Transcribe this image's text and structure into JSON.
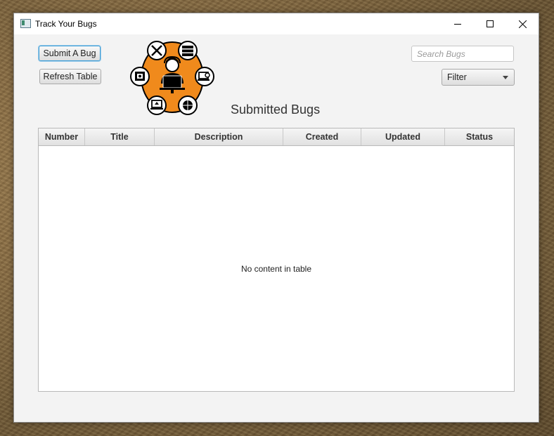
{
  "window": {
    "title": "Track Your Bugs",
    "controls": [
      "minimize-icon",
      "maximize-icon",
      "close-icon"
    ]
  },
  "toolbar": {
    "submit_label": "Submit A Bug",
    "refresh_label": "Refresh Table"
  },
  "search": {
    "placeholder": "Search Bugs",
    "value": ""
  },
  "filter": {
    "selected": "Filter"
  },
  "main": {
    "heading": "Submitted Bugs"
  },
  "table": {
    "columns": [
      "Number",
      "Title",
      "Description",
      "Created",
      "Updated",
      "Status"
    ],
    "rows": [],
    "empty_text": "No content in table"
  },
  "logo": {
    "icons": [
      "tools-icon",
      "server-icon",
      "laptop-search-icon",
      "globe-icon",
      "laptop-upload-icon",
      "monitor-share-icon",
      "developer-icon"
    ]
  },
  "colors": {
    "logo_orange": "#f08a1c",
    "focus_blue": "#3e9ed6"
  }
}
